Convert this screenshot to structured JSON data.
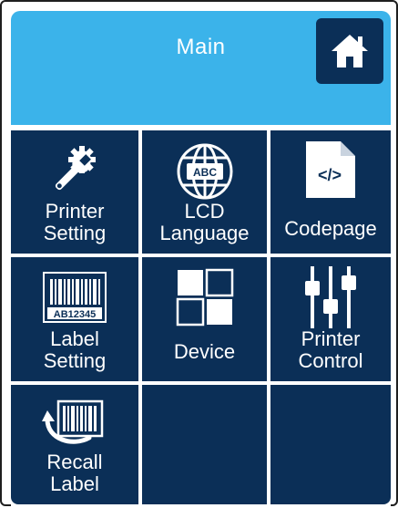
{
  "header": {
    "title": "Main",
    "home_icon": "home-icon",
    "background": "#3bb3ea"
  },
  "tiles": [
    {
      "label": "Printer\nSetting",
      "icon": "wrench-gear-icon"
    },
    {
      "label": "LCD\nLanguage",
      "icon": "globe-abc-icon"
    },
    {
      "label": "Codepage",
      "icon": "code-file-icon"
    },
    {
      "label": "Label\nSetting",
      "icon": "barcode-label-icon",
      "icon_text": "AB12345"
    },
    {
      "label": "Device",
      "icon": "device-squares-icon"
    },
    {
      "label": "Printer\nControl",
      "icon": "sliders-icon"
    },
    {
      "label": "Recall\nLabel",
      "icon": "recall-barcode-icon"
    }
  ],
  "colors": {
    "tile": "#0b2f57",
    "header": "#3bb3ea",
    "text": "#ffffff"
  }
}
